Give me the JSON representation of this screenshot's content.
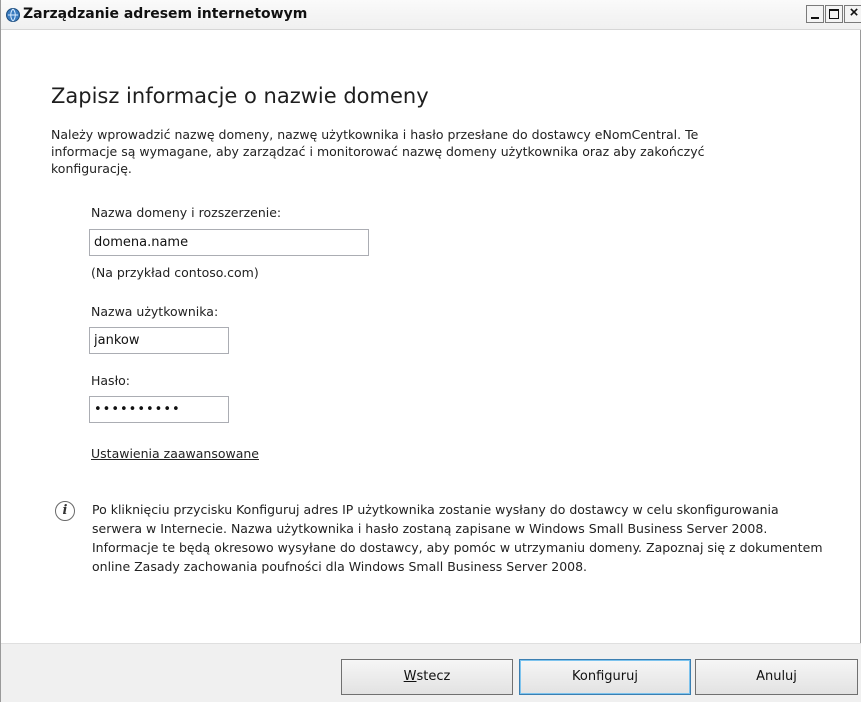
{
  "window": {
    "title": "Zarządzanie adresem internetowym",
    "controls": {
      "minimize": "_",
      "maximize": "□",
      "close": "×"
    }
  },
  "page": {
    "heading": "Zapisz informacje o nazwie domeny",
    "intro": "Należy wprowadzić nazwę domeny, nazwę użytkownika i hasło przesłane do dostawcy eNomCentral. Te informacje są wymagane, aby zarządzać i monitorować nazwę domeny użytkownika oraz aby zakończyć konfigurację."
  },
  "form": {
    "domain": {
      "label": "Nazwa domeny i rozszerzenie:",
      "value": "domena.name",
      "hint": "(Na przykład contoso.com)"
    },
    "username": {
      "label": "Nazwa użytkownika:",
      "value": "jankow"
    },
    "password": {
      "label": "Hasło:",
      "value": "••••••••••"
    },
    "advanced_link": "Ustawienia zaawansowane"
  },
  "info": {
    "icon": "info-icon",
    "text": "Po kliknięciu przycisku Konfiguruj adres IP użytkownika zostanie wysłany do dostawcy w celu skonfigurowania serwera w Internecie. Nazwa użytkownika i hasło zostaną zapisane w Windows Small Business Server 2008. Informacje te będą okresowo wysyłane do dostawcy, aby pomóc w utrzymaniu domeny. Zapoznaj się z dokumentem online Zasady zachowania poufności dla Windows Small Business Server 2008."
  },
  "buttons": {
    "back_accel": "W",
    "back_rest": "stecz",
    "configure": "Konfiguruj",
    "cancel": "Anuluj"
  }
}
